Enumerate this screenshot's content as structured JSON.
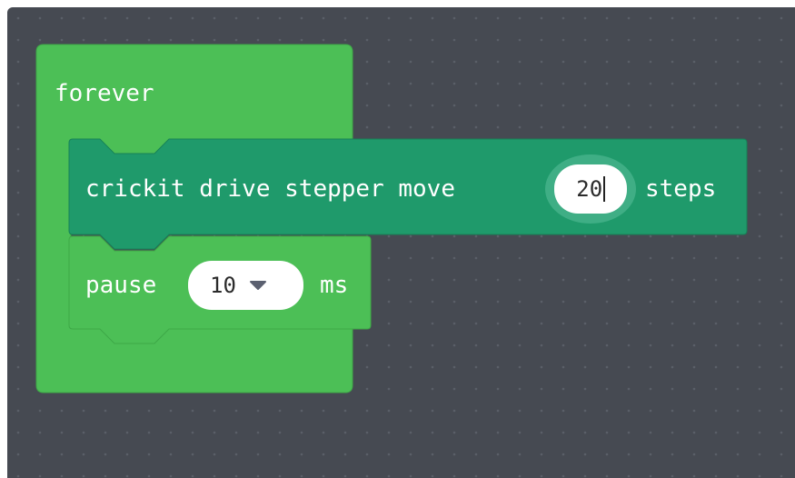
{
  "workspace": {
    "background": "#464a52",
    "dot_color": "#5a5f68"
  },
  "blocks": {
    "forever": {
      "label": "forever",
      "color": "#4cbf56",
      "stroke": "#3ea847"
    },
    "stepper": {
      "prefix": "crickit drive stepper move",
      "value": "20",
      "suffix": "steps",
      "color": "#1f9a6b",
      "stroke": "#178257"
    },
    "pause": {
      "prefix": "pause",
      "value": "10",
      "suffix": "ms",
      "dropdown_icon": "triangle-down-icon",
      "color": "#4cbf56",
      "stroke": "#3ea847"
    }
  }
}
